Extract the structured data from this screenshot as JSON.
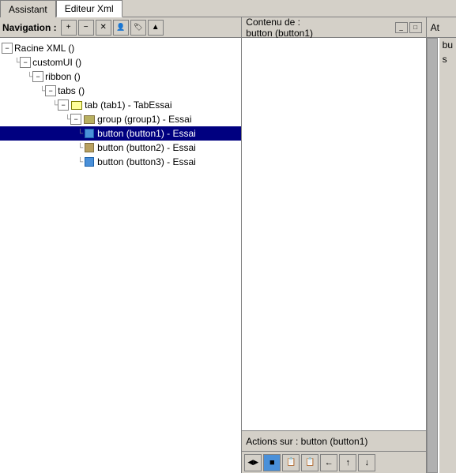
{
  "tabs": [
    {
      "id": "assistant",
      "label": "Assistant",
      "active": false
    },
    {
      "id": "editeur-xml",
      "label": "Editeur Xml",
      "active": true
    }
  ],
  "nav": {
    "label": "Navigation :",
    "toolbar_buttons": [
      "+",
      "−",
      "✕",
      "👤",
      "🏷",
      "▲"
    ],
    "tree": [
      {
        "id": "racine-xml",
        "indent": 0,
        "has_expand": true,
        "expanded": true,
        "icon": "none",
        "text": "Racine XML ()"
      },
      {
        "id": "customUI",
        "indent": 1,
        "has_expand": true,
        "expanded": true,
        "icon": "none",
        "text": "customUI ()"
      },
      {
        "id": "ribbon",
        "indent": 2,
        "has_expand": true,
        "expanded": true,
        "icon": "none",
        "text": "ribbon ()"
      },
      {
        "id": "tabs",
        "indent": 3,
        "has_expand": true,
        "expanded": true,
        "icon": "none",
        "text": "tabs ()"
      },
      {
        "id": "tab1",
        "indent": 4,
        "has_expand": true,
        "expanded": true,
        "icon": "folder-open",
        "text": "tab (tab1) - TabEssai"
      },
      {
        "id": "group1",
        "indent": 5,
        "has_expand": true,
        "expanded": true,
        "icon": "folder-tan",
        "text": "group (group1) - Essai"
      },
      {
        "id": "button1",
        "indent": 6,
        "has_expand": false,
        "expanded": false,
        "icon": "blue-sq",
        "text": "button (button1) - Essai",
        "selected": true
      },
      {
        "id": "button2",
        "indent": 6,
        "has_expand": false,
        "expanded": false,
        "icon": "tan-sq",
        "text": "button (button2) - Essai"
      },
      {
        "id": "button3",
        "indent": 6,
        "has_expand": false,
        "expanded": false,
        "icon": "blue-sq",
        "text": "button (button3) - Essai"
      }
    ]
  },
  "center": {
    "header": "Contenu de :",
    "header_sub": "button (button1)",
    "footer": "Actions sur : button (button1)",
    "action_buttons": [
      "◀▶",
      "■",
      "📄",
      "📄",
      "←",
      "↑",
      "↓"
    ]
  },
  "right": {
    "header": "At",
    "sub": "bu",
    "sub2": "s"
  }
}
